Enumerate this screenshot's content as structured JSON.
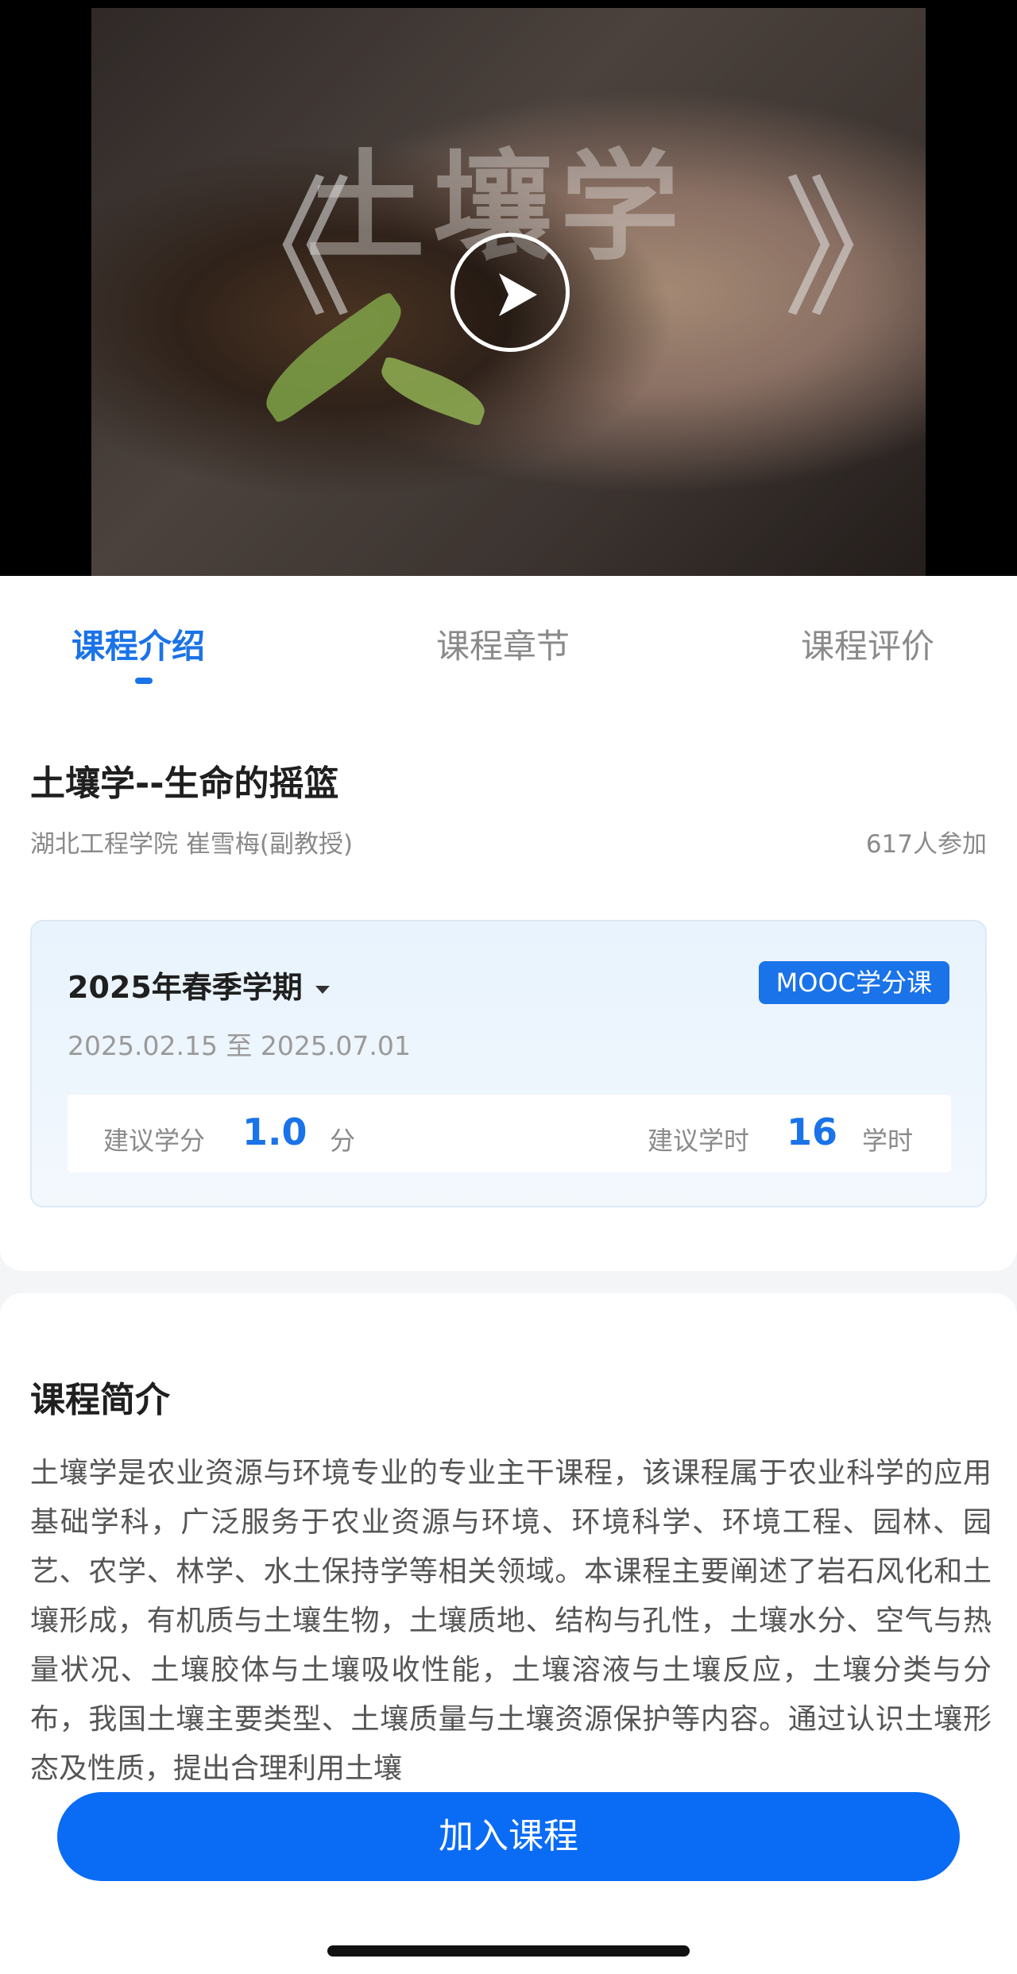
{
  "video": {
    "art_title": "土壤学",
    "left_bracket": "《",
    "right_bracket": "》"
  },
  "tabs": [
    {
      "label": "课程介绍",
      "active": true
    },
    {
      "label": "课程章节",
      "active": false
    },
    {
      "label": "课程评价",
      "active": false
    }
  ],
  "course": {
    "title": "土壤学--生命的摇篮",
    "teacher": "湖北工程学院 崔雪梅(副教授)",
    "participants": "617人参加"
  },
  "semester": {
    "name": "2025年春季学期",
    "badge": "MOOC学分课",
    "date_range": "2025.02.15 至 2025.07.01",
    "credit_label": "建议学分",
    "credit_value": "1.0",
    "credit_unit": "分",
    "hours_label": "建议学时",
    "hours_value": "16",
    "hours_unit": "学时"
  },
  "intro": {
    "heading": "课程简介",
    "text": "土壤学是农业资源与环境专业的专业主干课程，该课程属于农业科学的应用基础学科，广泛服务于农业资源与环境、环境科学、环境工程、园林、园艺、农学、林学、水土保持学等相关领域。本课程主要阐述了岩石风化和土壤形成，有机质与土壤生物，土壤质地、结构与孔性，土壤水分、空气与热量状况、土壤胶体与土壤吸收性能，土壤溶液与土壤反应，土壤分类与分布，我国土壤主要类型、土壤质量与土壤资源保护等内容。通过认识土壤形态及性质，提出合理利用土壤"
  },
  "actions": {
    "join_label": "加入课程"
  },
  "colors": {
    "accent": "#1a73e8",
    "join_button": "#0a6cf5"
  }
}
